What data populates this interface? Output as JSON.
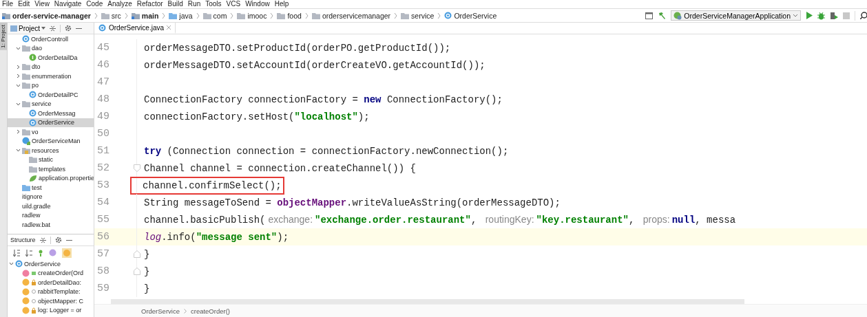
{
  "menu": [
    "File",
    "Edit",
    "View",
    "Navigate",
    "Code",
    "Analyze",
    "Refactor",
    "Build",
    "Run",
    "Tools",
    "VCS",
    "Window",
    "Help"
  ],
  "breadcrumb": [
    {
      "label": "order-service-manager",
      "kind": "module"
    },
    {
      "label": "src",
      "kind": "folder"
    },
    {
      "label": "main",
      "kind": "module"
    },
    {
      "label": "java",
      "kind": "source"
    },
    {
      "label": "com",
      "kind": "folder"
    },
    {
      "label": "imooc",
      "kind": "folder"
    },
    {
      "label": "food",
      "kind": "folder"
    },
    {
      "label": "orderservicemanager",
      "kind": "folder"
    },
    {
      "label": "service",
      "kind": "folder"
    },
    {
      "label": "OrderService",
      "kind": "class"
    }
  ],
  "run_config": "OrderServiceManagerApplication",
  "tool_strip": "1: Project",
  "project": {
    "title": "Project",
    "tree": [
      {
        "label": "OrderControll",
        "kind": "class",
        "selected": false
      },
      {
        "label": "dao",
        "kind": "folder",
        "expanded": true,
        "selected": false,
        "children": [
          {
            "label": "OrderDetailDa",
            "kind": "interface",
            "selected": false
          }
        ]
      },
      {
        "label": "dto",
        "kind": "folder",
        "expanded": false,
        "selected": false
      },
      {
        "label": "enummeration",
        "kind": "folder",
        "expanded": false,
        "selected": false
      },
      {
        "label": "po",
        "kind": "folder",
        "expanded": true,
        "selected": false,
        "children": [
          {
            "label": "OrderDetailPC",
            "kind": "class",
            "selected": false
          }
        ]
      },
      {
        "label": "service",
        "kind": "folder",
        "expanded": true,
        "selected": false,
        "children": [
          {
            "label": "OrderMessag",
            "kind": "class",
            "selected": false
          },
          {
            "label": "OrderService",
            "kind": "class",
            "selected": true
          }
        ]
      },
      {
        "label": "vo",
        "kind": "folder",
        "expanded": false,
        "selected": false
      },
      {
        "label": "OrderServiceMan",
        "kind": "app",
        "selected": false
      },
      {
        "label": "resources",
        "kind": "resources",
        "expanded": true,
        "selected": false,
        "children": [
          {
            "label": "static",
            "kind": "folder",
            "selected": false
          },
          {
            "label": "templates",
            "kind": "folder",
            "selected": false
          },
          {
            "label": "application.propertie",
            "kind": "config",
            "selected": false
          }
        ]
      },
      {
        "label": "test",
        "kind": "source",
        "selected": false
      },
      {
        "label": "itignore",
        "kind": "file",
        "selected": false
      },
      {
        "label": "uild.gradle",
        "kind": "file",
        "selected": false
      },
      {
        "label": "radlew",
        "kind": "file",
        "selected": false
      },
      {
        "label": "radlew.bat",
        "kind": "file",
        "selected": false
      }
    ]
  },
  "structure": {
    "title": "Structure",
    "tree": [
      {
        "label": "OrderService",
        "kind": "class",
        "expanded": true,
        "children": [
          {
            "label": "createOrder(Ord",
            "kind": "publicmethod"
          },
          {
            "label": "orderDetailDao:",
            "kind": "privatefield"
          },
          {
            "label": "rabbitTemplate:",
            "kind": "packagefield"
          },
          {
            "label": "objectMapper: C",
            "kind": "packagefield"
          },
          {
            "label": "log: Logger = or",
            "kind": "privatefield"
          }
        ]
      }
    ]
  },
  "editor": {
    "tabs": [
      {
        "label": "OrderService.java",
        "selected": true
      }
    ],
    "lines": [
      {
        "number": "45",
        "tokens": [
          {
            "kind": "plain",
            "text": "        orderMessageDTO.setProductId(orderPO.getProductId());"
          }
        ]
      },
      {
        "number": "46",
        "tokens": [
          {
            "kind": "plain",
            "text": "        orderMessageDTO.setAccountId(orderCreateVO.getAccountId());"
          }
        ]
      },
      {
        "number": "47"
      },
      {
        "number": "48",
        "tokens": [
          {
            "kind": "plain",
            "text": "        ConnectionFactory connectionFactory = "
          },
          {
            "kind": "keyword",
            "text": "new"
          },
          {
            "kind": "plain",
            "text": " ConnectionFactory();"
          }
        ]
      },
      {
        "number": "49",
        "tokens": [
          {
            "kind": "plain",
            "text": "        connectionFactory.setHost("
          },
          {
            "kind": "string",
            "text": "\"localhost\""
          },
          {
            "kind": "plain",
            "text": ");"
          }
        ]
      },
      {
        "number": "50"
      },
      {
        "number": "51",
        "tokens": [
          {
            "kind": "keyword",
            "text": "        try"
          },
          {
            "kind": "plain",
            "text": " (Connection connection = connectionFactory.newConnection();"
          }
        ]
      },
      {
        "number": "52",
        "fold_start": true,
        "tokens": [
          {
            "kind": "plain",
            "text": "             Channel channel = connection.createChannel()) {"
          }
        ]
      },
      {
        "number": "53",
        "boxed": true,
        "tokens": [
          {
            "kind": "plain",
            "text": "            channel.confirmSelect();"
          }
        ]
      },
      {
        "number": "54",
        "tokens": [
          {
            "kind": "plain",
            "text": "            String messageToSend = "
          },
          {
            "kind": "field",
            "text": "objectMapper"
          },
          {
            "kind": "plain",
            "text": ".writeValueAsString(orderMessageDTO);"
          }
        ]
      },
      {
        "number": "55",
        "tokens": [
          {
            "kind": "plain",
            "text": "            channel.basicPublish("
          },
          {
            "kind": "hint",
            "text": "exchange:"
          },
          {
            "kind": "string",
            "text": "\"exchange.order.restaurant\""
          },
          {
            "kind": "plain",
            "text": ", "
          },
          {
            "kind": "hint",
            "text": "routingKey:"
          },
          {
            "kind": "string",
            "text": "\"key.restaurant\""
          },
          {
            "kind": "plain",
            "text": ", "
          },
          {
            "kind": "hint",
            "text": "props:"
          },
          {
            "kind": "keyword",
            "text": "null"
          },
          {
            "kind": "plain",
            "text": ", messa"
          }
        ]
      },
      {
        "number": "56",
        "current": true,
        "tokens": [
          {
            "kind": "static",
            "text": "            log"
          },
          {
            "kind": "plain",
            "text": ".info("
          },
          {
            "kind": "string",
            "text": "\"message sent\""
          },
          {
            "kind": "plain",
            "text": ");"
          }
        ]
      },
      {
        "number": "57",
        "fold_end": true,
        "tokens": [
          {
            "kind": "plain",
            "text": "        }"
          }
        ]
      },
      {
        "number": "58",
        "fold_end": true,
        "tokens": [
          {
            "kind": "plain",
            "text": "    }"
          }
        ]
      },
      {
        "number": "59",
        "tokens": [
          {
            "kind": "plain",
            "text": "}"
          }
        ]
      }
    ],
    "breadcrumb": [
      "OrderService",
      "createOrder()"
    ]
  }
}
